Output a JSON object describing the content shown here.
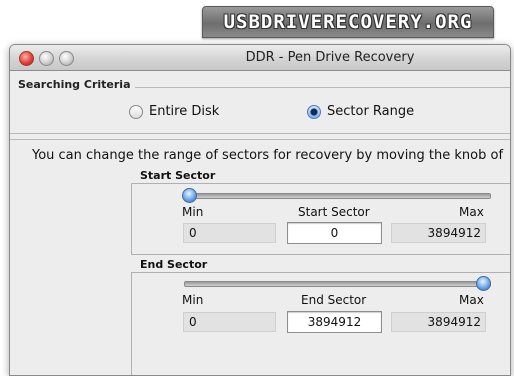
{
  "banner": {
    "text": "USBDRIVERECOVERY.ORG"
  },
  "window": {
    "title": "DDR - Pen Drive Recovery"
  },
  "searching_criteria": {
    "label": "Searching Criteria",
    "options": [
      {
        "label": "Entire Disk",
        "selected": false
      },
      {
        "label": "Sector Range",
        "selected": true
      }
    ]
  },
  "info_text": "You can change the range of sectors for recovery by moving the knob of",
  "start_sector": {
    "group_label": "Start Sector",
    "min_label": "Min",
    "value_label": "Start Sector",
    "max_label": "Max",
    "min_value": "0",
    "value": "0",
    "max_value": "3894912",
    "slider_fraction": 0
  },
  "end_sector": {
    "group_label": "End Sector",
    "min_label": "Min",
    "value_label": "End Sector",
    "max_label": "Max",
    "min_value": "0",
    "value": "3894912",
    "max_value": "3894912",
    "slider_fraction": 1
  },
  "colors": {
    "knob": "#6da7e8",
    "window_bg": "#ededed",
    "close_light": "#e0443a"
  }
}
